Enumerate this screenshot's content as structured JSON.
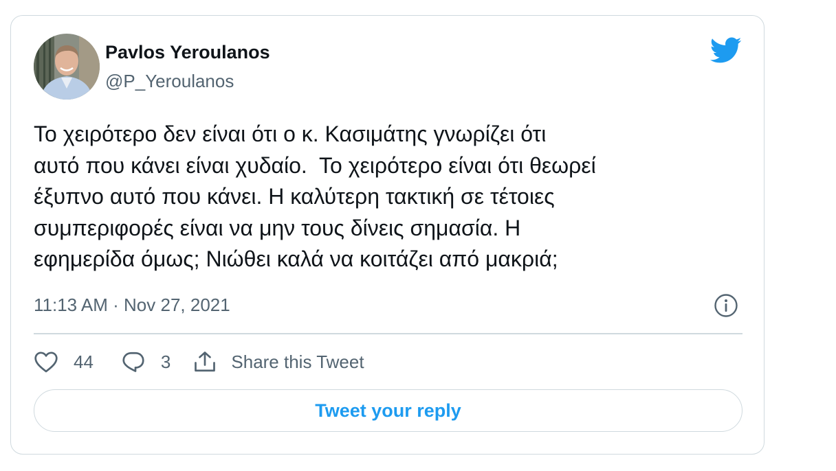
{
  "author": {
    "display_name": "Pavlos Yeroulanos",
    "handle": "@P_Yeroulanos",
    "avatar_icon": "profile-photo"
  },
  "logo_icon": "twitter-bird-icon",
  "tweet": {
    "text": "Το χειρότερο δεν είναι ότι ο κ. Κασιμάτης γνωρίζει ότι\nαυτό που κάνει είναι χυδαίο.  Το χειρότερο είναι ότι θεωρεί\nέξυπνο αυτό που κάνει. Η καλύτερη τακτική σε τέτοιες\nσυμπεριφορές είναι να μην τους δίνεις σημασία. Η\nεφημερίδα όμως; Νιώθει καλά να κοιτάζει από μακριά;",
    "timestamp": "11:13 AM · Nov 27, 2021"
  },
  "actions": {
    "likes": "44",
    "replies": "3",
    "share_label": "Share this Tweet"
  },
  "reply_button": {
    "label": "Tweet your reply"
  },
  "colors": {
    "accent": "#1d9bf0",
    "text_primary": "#0f1419",
    "text_secondary": "#536471",
    "border": "#cfd9de"
  }
}
